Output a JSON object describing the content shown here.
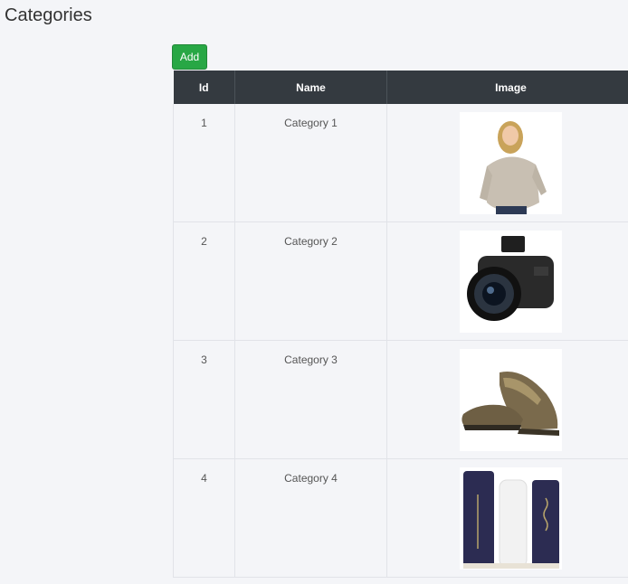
{
  "page": {
    "title": "Categories"
  },
  "toolbar": {
    "add_label": "Add"
  },
  "table": {
    "headers": {
      "id": "Id",
      "name": "Name",
      "image": "Image"
    },
    "rows": [
      {
        "id": "1",
        "name": "Category 1",
        "image": "woman-in-sweater-photo"
      },
      {
        "id": "2",
        "name": "Category 2",
        "image": "camera-photo"
      },
      {
        "id": "3",
        "name": "Category 3",
        "image": "hiking-shoes-photo"
      },
      {
        "id": "4",
        "name": "Category 4",
        "image": "skincare-products-photo"
      }
    ]
  },
  "colors": {
    "accent": "#28a745",
    "header_bg": "#343a40",
    "page_bg": "#f4f5f8"
  }
}
